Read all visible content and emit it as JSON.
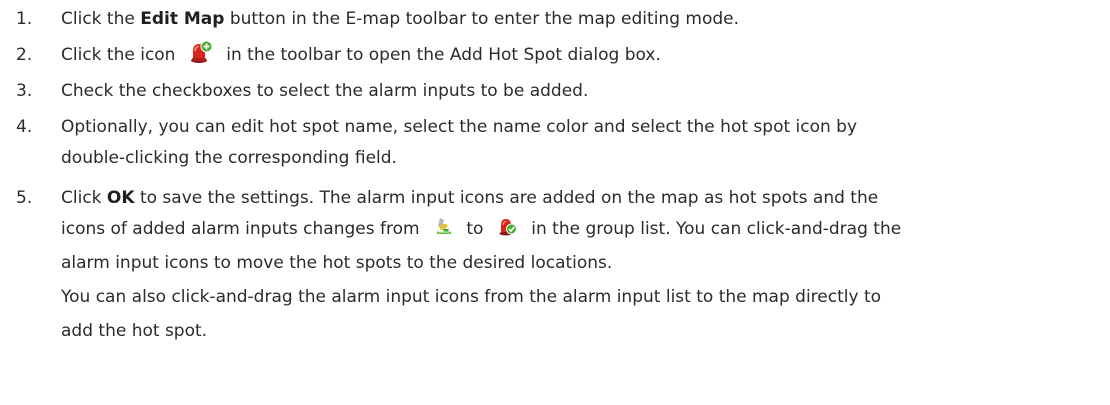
{
  "steps": [
    {
      "number": "1.",
      "before": "Click the ",
      "bold": "Edit Map",
      "after": " button in the E-map toolbar to enter the map editing mode."
    },
    {
      "number": "2.",
      "before": "Click the icon",
      "icon": "add-hot-spot-icon",
      "after": "in the toolbar to open the Add Hot Spot dialog box."
    },
    {
      "number": "3.",
      "text": "Check the checkboxes to select the alarm inputs to be added."
    },
    {
      "number": "4.",
      "line1": "Optionally, you can edit hot spot name, select the name color and select the hot spot icon by",
      "line2": "double-clicking the corresponding field."
    },
    {
      "number": "5.",
      "l1_before": "Click ",
      "l1_bold": "OK",
      "l1_after": " to save the settings. The alarm input icons are added on the map as hot spots and the",
      "l2_before": "icons of added alarm inputs changes from",
      "l2_icon_from": "alarm-input-icon",
      "l2_mid": "to",
      "l2_icon_to": "added-alarm-input-icon",
      "l2_after": "in the group list. You can click-and-drag the",
      "line3": "alarm input icons to move the hot spots to the desired locations.",
      "note_line1": "You can also click-and-drag the alarm input icons from the alarm input list to the map directly to",
      "note_line2": "add the hot spot."
    }
  ],
  "colors": {
    "text": "#2b2b2b",
    "icon_red": "#d8281e",
    "icon_green": "#3fae2a"
  }
}
